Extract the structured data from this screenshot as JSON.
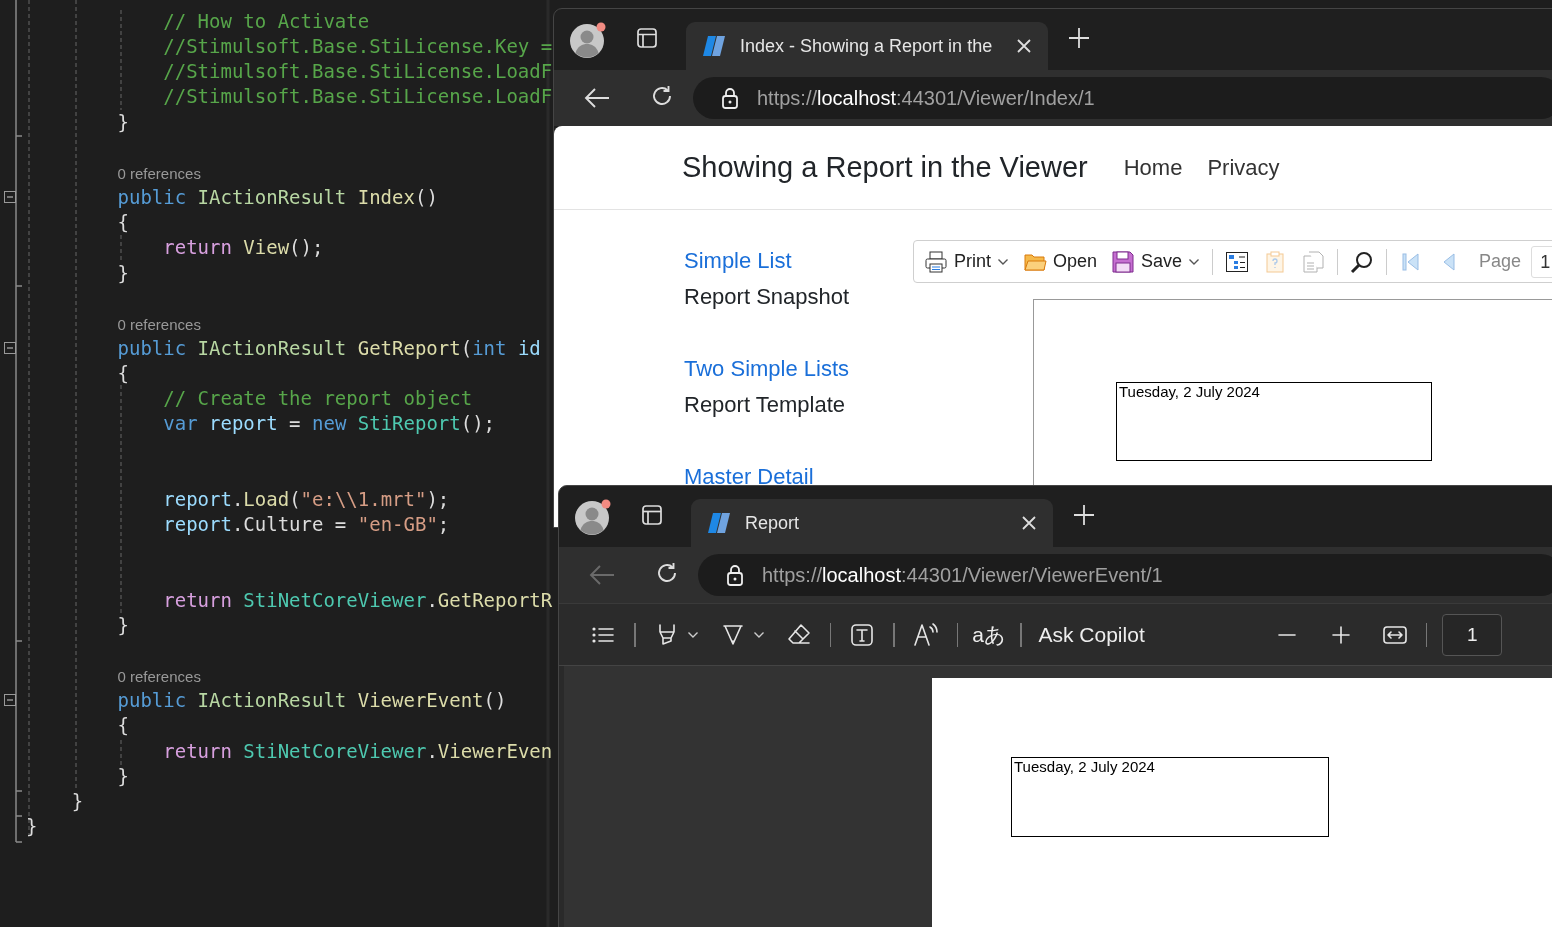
{
  "editor": {
    "lines": [
      {
        "kind": "code",
        "tokens": [
          {
            "kind": "comment",
            "text": "            // How to Activate"
          }
        ]
      },
      {
        "kind": "code",
        "tokens": [
          {
            "kind": "comment",
            "text": "            //Stimulsoft.Base.StiLicense.Key ="
          }
        ]
      },
      {
        "kind": "code",
        "tokens": [
          {
            "kind": "comment",
            "text": "            //Stimulsoft.Base.StiLicense.LoadF"
          }
        ]
      },
      {
        "kind": "code",
        "tokens": [
          {
            "kind": "comment",
            "text": "            //Stimulsoft.Base.StiLicense.LoadF"
          }
        ]
      },
      {
        "kind": "code",
        "tokens": [
          {
            "kind": "plain",
            "text": "        }"
          }
        ]
      },
      {
        "kind": "blank"
      },
      {
        "kind": "codelens",
        "text": "0 references"
      },
      {
        "kind": "code",
        "expanded": true,
        "tokens": [
          {
            "kind": "keyword",
            "text": "        public "
          },
          {
            "kind": "iface",
            "text": "IActionResult "
          },
          {
            "kind": "method",
            "text": "Index"
          },
          {
            "kind": "plain",
            "text": "()"
          }
        ]
      },
      {
        "kind": "code",
        "tokens": [
          {
            "kind": "plain",
            "text": "        {"
          }
        ]
      },
      {
        "kind": "code",
        "tokens": [
          {
            "kind": "control",
            "text": "            return "
          },
          {
            "kind": "method",
            "text": "View"
          },
          {
            "kind": "plain",
            "text": "();"
          }
        ]
      },
      {
        "kind": "code",
        "tokens": [
          {
            "kind": "plain",
            "text": "        }"
          }
        ]
      },
      {
        "kind": "blank"
      },
      {
        "kind": "codelens",
        "text": "0 references"
      },
      {
        "kind": "code",
        "expanded": true,
        "tokens": [
          {
            "kind": "keyword",
            "text": "        public "
          },
          {
            "kind": "iface",
            "text": "IActionResult "
          },
          {
            "kind": "method",
            "text": "GetReport"
          },
          {
            "kind": "plain",
            "text": "("
          },
          {
            "kind": "keyword",
            "text": "int "
          },
          {
            "kind": "variable",
            "text": "id"
          }
        ]
      },
      {
        "kind": "code",
        "tokens": [
          {
            "kind": "plain",
            "text": "        {"
          }
        ]
      },
      {
        "kind": "code",
        "tokens": [
          {
            "kind": "comment",
            "text": "            // Create the report object"
          }
        ]
      },
      {
        "kind": "code",
        "tokens": [
          {
            "kind": "keyword",
            "text": "            var "
          },
          {
            "kind": "variable",
            "text": "report"
          },
          {
            "kind": "plain",
            "text": " = "
          },
          {
            "kind": "keyword",
            "text": "new "
          },
          {
            "kind": "type",
            "text": "StiReport"
          },
          {
            "kind": "plain",
            "text": "();"
          }
        ]
      },
      {
        "kind": "blank"
      },
      {
        "kind": "blank"
      },
      {
        "kind": "code",
        "tokens": [
          {
            "kind": "variable",
            "text": "            report"
          },
          {
            "kind": "plain",
            "text": "."
          },
          {
            "kind": "method",
            "text": "Load"
          },
          {
            "kind": "plain",
            "text": "("
          },
          {
            "kind": "string",
            "text": "\"e:\\\\1.mrt\""
          },
          {
            "kind": "plain",
            "text": ");"
          }
        ]
      },
      {
        "kind": "code",
        "tokens": [
          {
            "kind": "variable",
            "text": "            report"
          },
          {
            "kind": "plain",
            "text": ".Culture = "
          },
          {
            "kind": "string",
            "text": "\"en-GB\""
          },
          {
            "kind": "plain",
            "text": ";"
          }
        ]
      },
      {
        "kind": "blank"
      },
      {
        "kind": "blank"
      },
      {
        "kind": "code",
        "tokens": [
          {
            "kind": "control",
            "text": "            return "
          },
          {
            "kind": "type",
            "text": "StiNetCoreViewer"
          },
          {
            "kind": "plain",
            "text": "."
          },
          {
            "kind": "method",
            "text": "GetReportR"
          }
        ]
      },
      {
        "kind": "code",
        "tokens": [
          {
            "kind": "plain",
            "text": "        }"
          }
        ]
      },
      {
        "kind": "blank"
      },
      {
        "kind": "codelens",
        "text": "0 references"
      },
      {
        "kind": "code",
        "expanded": true,
        "tokens": [
          {
            "kind": "keyword",
            "text": "        public "
          },
          {
            "kind": "iface",
            "text": "IActionResult "
          },
          {
            "kind": "method",
            "text": "ViewerEvent"
          },
          {
            "kind": "plain",
            "text": "()"
          }
        ]
      },
      {
        "kind": "code",
        "tokens": [
          {
            "kind": "plain",
            "text": "        {"
          }
        ]
      },
      {
        "kind": "code",
        "tokens": [
          {
            "kind": "control",
            "text": "            return "
          },
          {
            "kind": "type",
            "text": "StiNetCoreViewer"
          },
          {
            "kind": "plain",
            "text": "."
          },
          {
            "kind": "method",
            "text": "ViewerEven"
          }
        ]
      },
      {
        "kind": "code",
        "tokens": [
          {
            "kind": "plain",
            "text": "        }"
          }
        ]
      },
      {
        "kind": "code",
        "tokens": [
          {
            "kind": "plain",
            "text": "    }"
          }
        ]
      },
      {
        "kind": "code",
        "tokens": [
          {
            "kind": "plain",
            "text": "}"
          }
        ]
      }
    ]
  },
  "browser_windows": [
    {
      "tab": {
        "title": "Index - Showing a Report in the",
        "selected": true
      },
      "back_disabled": false,
      "url": {
        "scheme": "https://",
        "host": "localhost",
        "path": ":44301/Viewer/Index/1"
      },
      "page": {
        "kind": "site",
        "title": "Showing a Report in the Viewer",
        "nav": [
          "Home",
          "Privacy"
        ],
        "reports": [
          {
            "link": "Simple List",
            "caption": "Report Snapshot"
          },
          {
            "link": "Two Simple Lists",
            "caption": "Report Template"
          },
          {
            "link": "Master Detail"
          }
        ],
        "toolbar": [
          {
            "kind": "print",
            "label": "Print",
            "dropdown": true,
            "disabled": false
          },
          {
            "kind": "open",
            "label": "Open",
            "disabled": false
          },
          {
            "kind": "save",
            "label": "Save",
            "dropdown": true,
            "disabled": false
          },
          {
            "kind": "separator"
          },
          {
            "kind": "tree",
            "disabled": false
          },
          {
            "kind": "clipboard",
            "disabled": true
          },
          {
            "kind": "pages",
            "disabled": true
          },
          {
            "kind": "separator"
          },
          {
            "kind": "search",
            "disabled": false
          },
          {
            "kind": "separator"
          },
          {
            "kind": "first",
            "disabled": true
          },
          {
            "kind": "prev",
            "disabled": true
          },
          {
            "kind": "page",
            "label": "Page",
            "value": "1"
          }
        ],
        "date": "Tuesday, 2 July 2024"
      }
    },
    {
      "tab": {
        "title": "Report",
        "selected": true
      },
      "back_disabled": true,
      "url": {
        "scheme": "https://",
        "host": "localhost",
        "path": ":44301/Viewer/ViewerEvent/1"
      },
      "page": {
        "kind": "pdf",
        "toolbar": [
          {
            "kind": "contents"
          },
          {
            "kind": "separator"
          },
          {
            "kind": "highlight"
          },
          {
            "kind": "dropdown"
          },
          {
            "kind": "draw"
          },
          {
            "kind": "dropdown"
          },
          {
            "kind": "erase"
          },
          {
            "kind": "separator"
          },
          {
            "kind": "textbox"
          },
          {
            "kind": "separator"
          },
          {
            "kind": "read-aloud"
          },
          {
            "kind": "separator"
          },
          {
            "kind": "translate",
            "text": "aあ"
          },
          {
            "kind": "separator"
          },
          {
            "kind": "copilot",
            "label": "Ask Copilot"
          },
          {
            "kind": "zoom-out"
          },
          {
            "kind": "zoom-in"
          },
          {
            "kind": "fit"
          },
          {
            "kind": "separator"
          },
          {
            "kind": "page",
            "value": "1"
          }
        ],
        "date": "Tuesday, 2 July 2024"
      }
    }
  ]
}
